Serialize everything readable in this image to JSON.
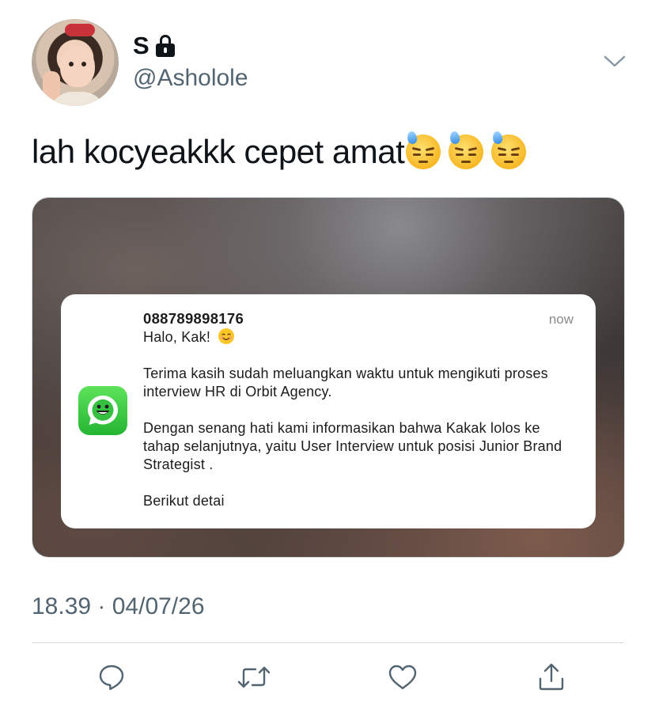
{
  "user": {
    "display_name": "S",
    "handle": "@Asholole",
    "protected_icon": "lock-icon",
    "avatar_icon": "profile-photo"
  },
  "tweet": {
    "text": "lah kocyeakkk cepet amat",
    "emojis": [
      "downcast-face-with-sweat",
      "downcast-face-with-sweat",
      "downcast-face-with-sweat"
    ]
  },
  "notification": {
    "app_icon": "whatsapp-icon",
    "sender": "088789898176",
    "time": "now",
    "greeting": "Halo, Kak!",
    "greeting_emoji": "smiling-face-icon",
    "paragraph1": "Terima kasih sudah meluangkan waktu untuk mengikuti proses interview HR di Orbit Agency.",
    "paragraph2": "Dengan senang hati kami informasikan bahwa Kakak lolos ke tahap selanjutnya, yaitu User Interview untuk posisi Junior Brand Strategist .",
    "paragraph3": "Berikut detai"
  },
  "meta": {
    "timestamp": "18.39 · 04/07/26"
  },
  "actions": [
    "reply-icon",
    "retweet-icon",
    "like-icon",
    "share-icon"
  ],
  "colors": {
    "text": "#0f1419",
    "secondary": "#536471",
    "divider": "#cfd9de",
    "whatsapp": "#25d366"
  }
}
